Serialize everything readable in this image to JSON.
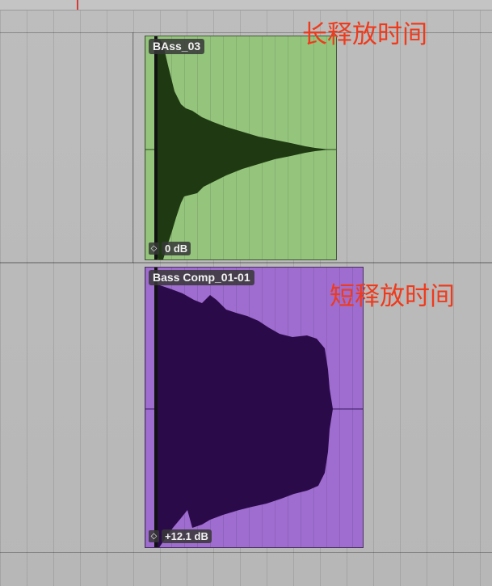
{
  "regions": [
    {
      "name": "BAss_03",
      "gain": "0 dB",
      "color": "#95c57d",
      "waveform_color": "#1f3a12"
    },
    {
      "name": "Bass Comp_01-01",
      "gain": "+12.1 dB",
      "color": "#9f6dd0",
      "waveform_color": "#2b0a4a"
    }
  ],
  "annotations": {
    "long_release": "长释放时间",
    "short_release": "短释放时间",
    "color": "#ef3a1c"
  },
  "icons": {
    "gain": "gain-handle-icon"
  }
}
